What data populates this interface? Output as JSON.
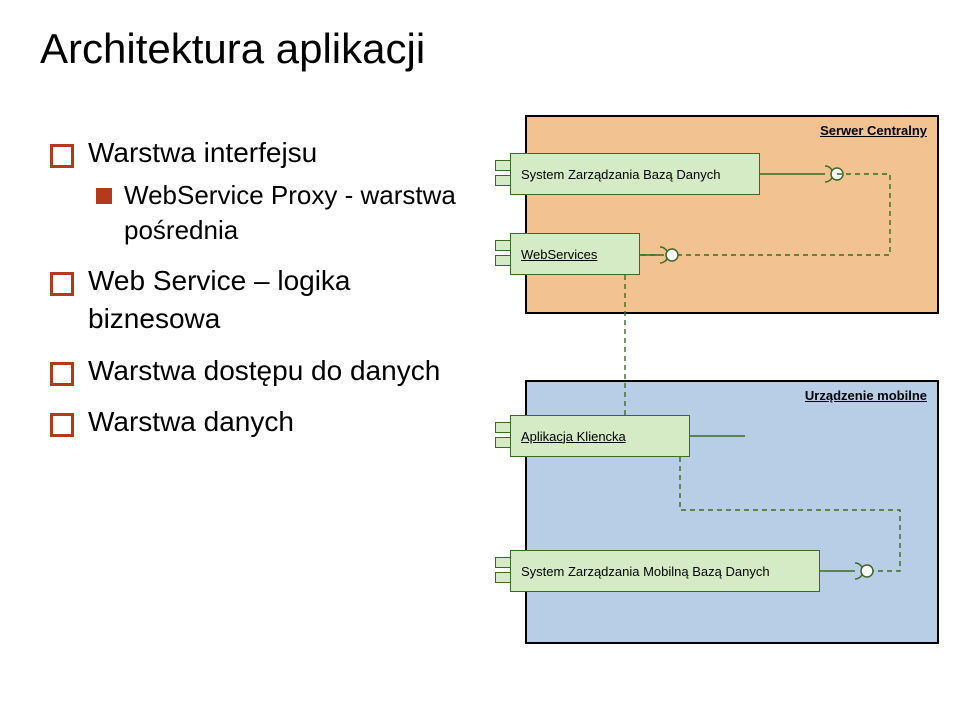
{
  "title": "Architektura aplikacji",
  "bullets": {
    "b1": "Warstwa interfejsu",
    "b1a": "WebService Proxy - warstwa pośrednia",
    "b2": "Web Service – logika biznesowa",
    "b3": "Warstwa dostępu do danych",
    "b4": "Warstwa danych"
  },
  "diagram": {
    "server_label": "Serwer Centralny",
    "device_label": "Urządzenie mobilne",
    "components": {
      "db": "System Zarządzania Bazą Danych",
      "ws": "WebServices",
      "app": "Aplikacja Kliencka",
      "mobdb": "System Zarządzania Mobilną Bazą Danych"
    }
  }
}
